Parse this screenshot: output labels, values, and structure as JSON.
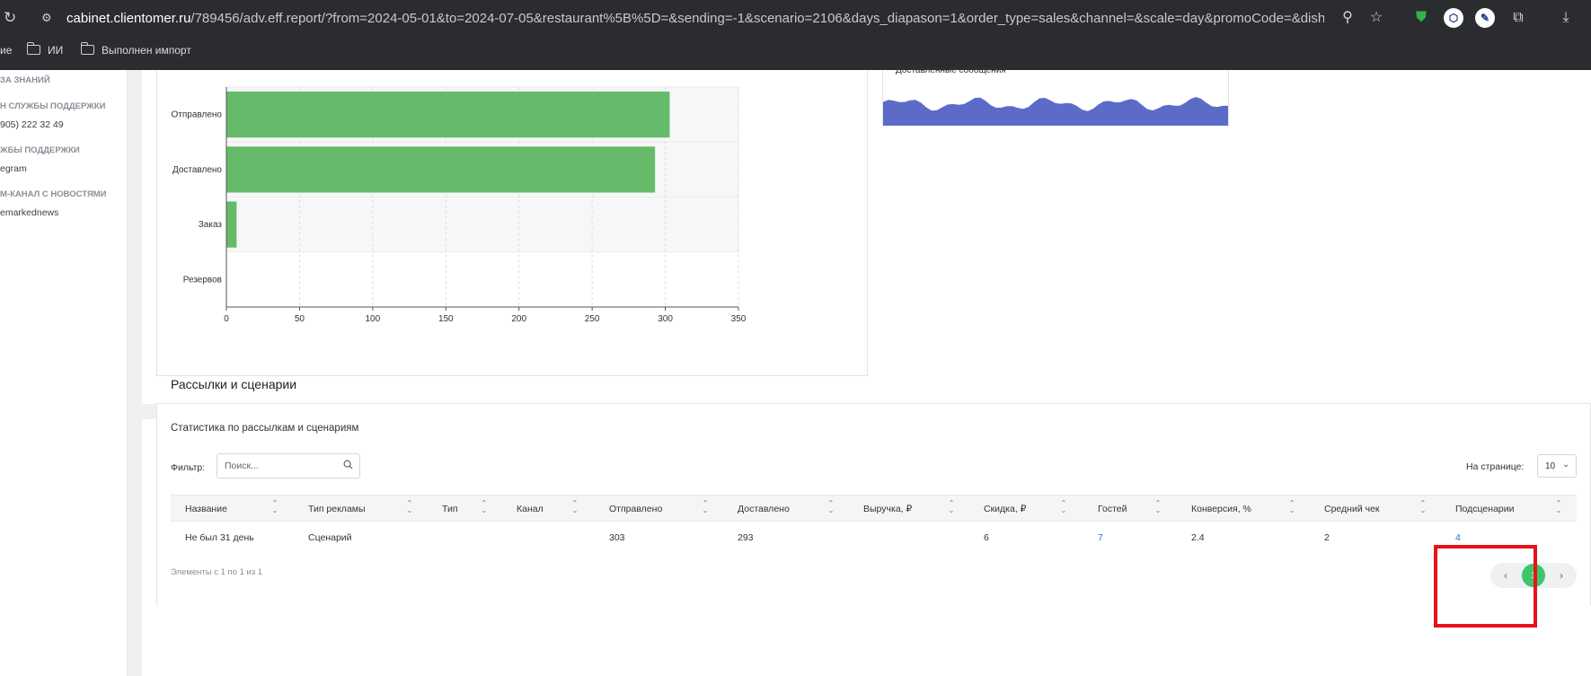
{
  "browser": {
    "url_host": "cabinet.clientomer.ru",
    "url_path": "/789456/adv.eff.report/?from=2024-05-01&to=2024-07-05&restaurant%5B%5D=&sending=-1&scenario=2106&days_diapason=1&order_type=sales&channel=&scale=day&promoCode=&dish=&guestC...",
    "bookmarks": [
      "ие",
      "ИИ",
      "Выполнен импорт"
    ]
  },
  "sidebar": {
    "items": [
      {
        "kind": "head",
        "text": "ЗА ЗНАНИЙ"
      },
      {
        "kind": "head",
        "text": "Н СЛУЖБЫ ПОДДЕРЖКИ"
      },
      {
        "kind": "val",
        "text": "905) 222 32 49"
      },
      {
        "kind": "head",
        "text": "ЖБЫ ПОДДЕРЖКИ"
      },
      {
        "kind": "val",
        "text": "egram"
      },
      {
        "kind": "head",
        "text": "М-КАНАЛ С НОВОСТЯМИ"
      },
      {
        "kind": "val",
        "text": "emarkednews"
      }
    ]
  },
  "mini_chart": {
    "title": "Доставленные сообщения",
    "color": "#5c6bc8"
  },
  "chart_data": {
    "type": "bar",
    "orientation": "horizontal",
    "categories": [
      "Отправлено",
      "Доставлено",
      "Заказ",
      "Резервов"
    ],
    "values": [
      303,
      293,
      7,
      0
    ],
    "xticks": [
      0,
      50,
      100,
      150,
      200,
      250,
      300,
      350
    ],
    "xlim": [
      0,
      350
    ],
    "color": "#66bb6a",
    "grid": true
  },
  "section": {
    "title": "Рассылки и сценарии",
    "subtitle": "Статистика по рассылкам и сценариям",
    "filter_label": "Фильтр:",
    "search_placeholder": "Поиск...",
    "per_page_label": "На странице:",
    "per_page_value": "10"
  },
  "table": {
    "columns": [
      "Название",
      "Тип рекламы",
      "Тип",
      "Канал",
      "Отправлено",
      "Доставлено",
      "Выручка, ₽",
      "Скидка, ₽",
      "Гостей",
      "Конверсия, %",
      "Средний чек",
      "Подсценарии"
    ],
    "rows": [
      [
        "Не был 31 день",
        "Сценарий",
        "",
        "",
        "303",
        "293",
        "",
        "6",
        "7",
        "2.4",
        "2",
        "4"
      ]
    ],
    "footer": "Элементы с 1 по 1 из 1",
    "current_page": "1"
  },
  "colors": {
    "accent_green": "#3ec56b",
    "link_blue": "#2f6fde",
    "highlight_red": "#e8121a"
  }
}
